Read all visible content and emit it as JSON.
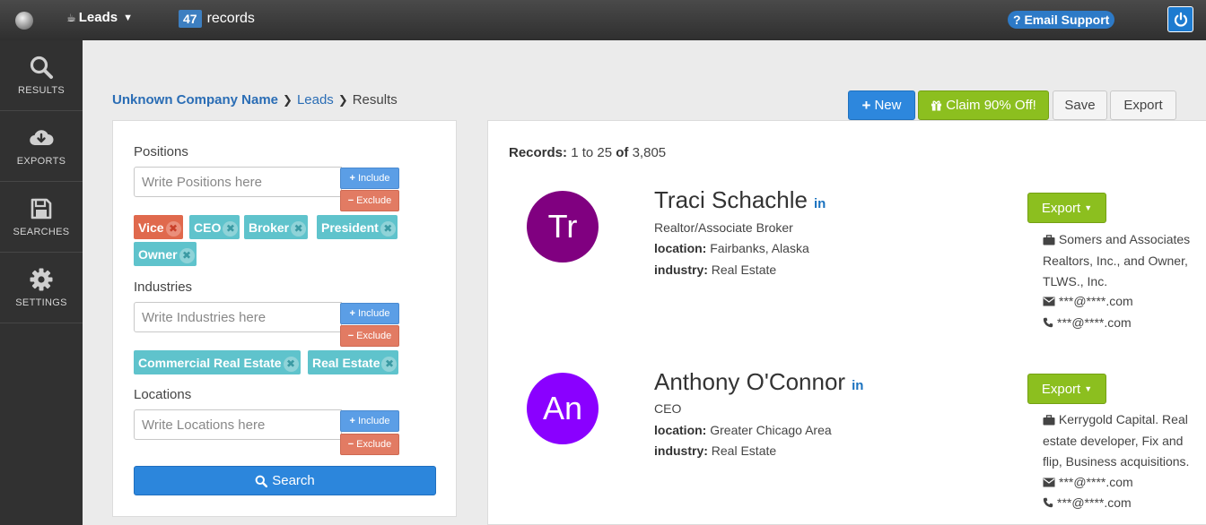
{
  "topbar": {
    "menu_label": "Leads",
    "record_count": "47",
    "record_label": "records",
    "email_support": "? Email Support"
  },
  "sidebar": {
    "items": [
      {
        "label": "RESULTS",
        "icon": "search-icon"
      },
      {
        "label": "EXPORTS",
        "icon": "cloud-download-icon"
      },
      {
        "label": "SEARCHES",
        "icon": "floppy-disk-icon"
      },
      {
        "label": "SETTINGS",
        "icon": "gear-icon"
      }
    ]
  },
  "breadcrumb": {
    "company": "Unknown Company Name",
    "leads": "Leads",
    "current": "Results"
  },
  "actions": {
    "new_label": "New",
    "claim_label": "Claim 90% Off!",
    "save_label": "Save",
    "export_label": "Export"
  },
  "filters": {
    "include_label": "Include",
    "exclude_label": "Exclude",
    "positions": {
      "label": "Positions",
      "placeholder": "Write Positions here",
      "tags": [
        {
          "text": "Vice",
          "mode": "exclude"
        },
        {
          "text": "CEO",
          "mode": "include"
        },
        {
          "text": "Broker",
          "mode": "include"
        },
        {
          "text": "President",
          "mode": "include"
        },
        {
          "text": "Owner",
          "mode": "include"
        }
      ]
    },
    "industries": {
      "label": "Industries",
      "placeholder": "Write Industries here",
      "tags": [
        {
          "text": "Commercial Real Estate",
          "mode": "include"
        },
        {
          "text": "Real Estate",
          "mode": "include"
        }
      ]
    },
    "locations": {
      "label": "Locations",
      "placeholder": "Write Locations here"
    },
    "search_label": "Search"
  },
  "results": {
    "summary_label": "Records:",
    "summary_range": "1 to 25",
    "summary_of": "of",
    "summary_total": "3,805",
    "export_label": "Export",
    "leads": [
      {
        "initials": "Tr",
        "avatar_color": "#800080",
        "name": "Traci Schachle",
        "linkedin": "in",
        "title": "Realtor/Associate Broker",
        "location_label": "location:",
        "location": "Fairbanks, Alaska",
        "industry_label": "industry:",
        "industry": "Real Estate",
        "company": "Somers and Associates Realtors, Inc., and Owner, TLWS., Inc.",
        "email": "***@****.com",
        "phone": "***@****.com"
      },
      {
        "initials": "An",
        "avatar_color": "#8a00ff",
        "name": "Anthony O'Connor",
        "linkedin": "in",
        "title": "CEO",
        "location_label": "location:",
        "location": "Greater Chicago Area",
        "industry_label": "industry:",
        "industry": "Real Estate",
        "company": "Kerrygold Capital. Real estate developer, Fix and flip, Business acquisitions.",
        "email": "***@****.com",
        "phone": "***@****.com"
      }
    ]
  }
}
